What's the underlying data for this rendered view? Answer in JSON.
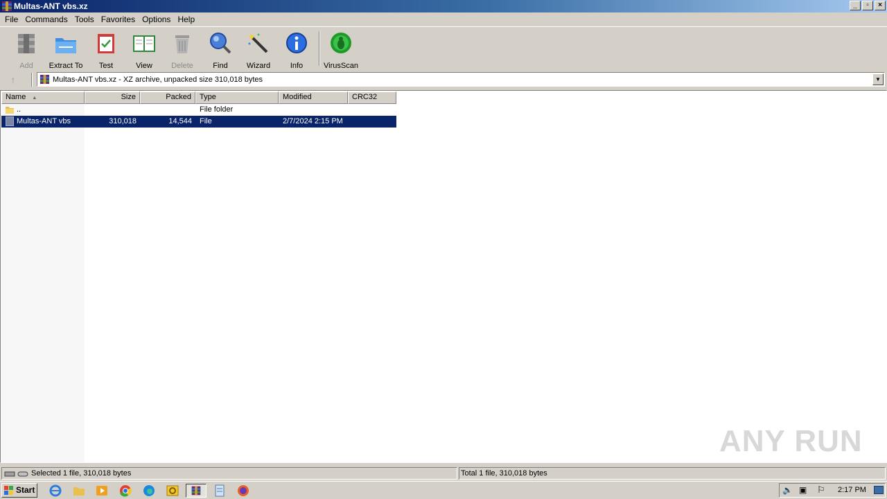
{
  "window": {
    "title": "Multas-ANT vbs.xz"
  },
  "menu": [
    "File",
    "Commands",
    "Tools",
    "Favorites",
    "Options",
    "Help"
  ],
  "toolbar": {
    "add": "Add",
    "extract_to": "Extract To",
    "test": "Test",
    "view": "View",
    "delete": "Delete",
    "find": "Find",
    "wizard": "Wizard",
    "info": "Info",
    "virusscan": "VirusScan"
  },
  "address": {
    "text": "Multas-ANT vbs.xz - XZ archive, unpacked size 310,018 bytes"
  },
  "columns": {
    "name": "Name",
    "size": "Size",
    "packed": "Packed",
    "type": "Type",
    "modified": "Modified",
    "crc32": "CRC32"
  },
  "rows": [
    {
      "name": "..",
      "size": "",
      "packed": "",
      "type": "File folder",
      "modified": "",
      "crc32": ""
    },
    {
      "name": "Multas-ANT vbs",
      "size": "310,018",
      "packed": "14,544",
      "type": "File",
      "modified": "2/7/2024 2:15 PM",
      "crc32": ""
    }
  ],
  "status": {
    "selected": "Selected 1 file, 310,018 bytes",
    "total": "Total 1 file, 310,018 bytes"
  },
  "watermark": "ANY RUN",
  "taskbar": {
    "start": "Start",
    "clock": "2:17 PM"
  },
  "colors": {
    "selection": "#0a246a",
    "titlebar_start": "#0a246a",
    "chrome": "#d4d0c8"
  }
}
